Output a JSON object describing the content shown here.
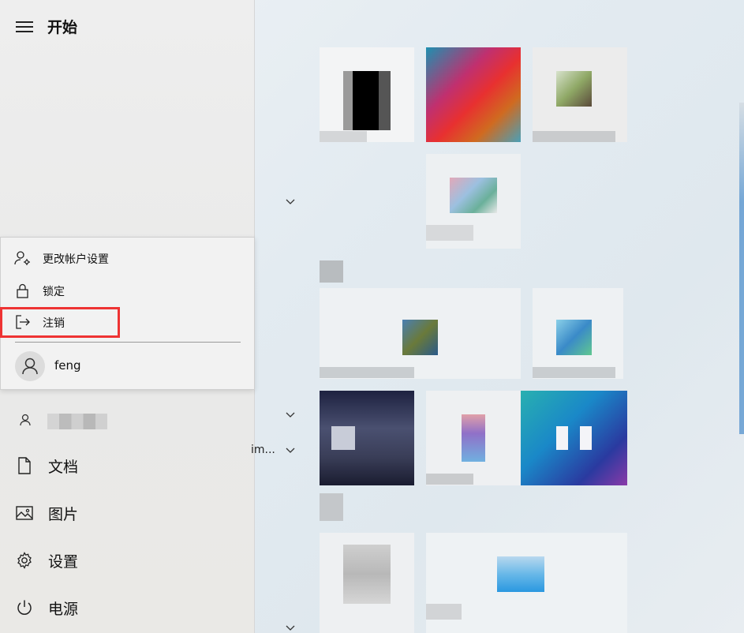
{
  "header": {
    "title": "开始"
  },
  "account_menu": {
    "items": [
      {
        "label": "更改帐户设置",
        "icon": "account-settings-icon"
      },
      {
        "label": "锁定",
        "icon": "lock-icon"
      },
      {
        "label": "注销",
        "icon": "sign-out-icon"
      }
    ],
    "user": {
      "name": "feng",
      "icon": "user-icon"
    },
    "highlight_color": "#ee3333"
  },
  "nav": [
    {
      "label": "文档",
      "icon": "document-icon"
    },
    {
      "label": "图片",
      "icon": "picture-icon"
    },
    {
      "label": "设置",
      "icon": "settings-icon"
    },
    {
      "label": "电源",
      "icon": "power-icon"
    }
  ],
  "tiles": {
    "truncated_label": "im..."
  }
}
